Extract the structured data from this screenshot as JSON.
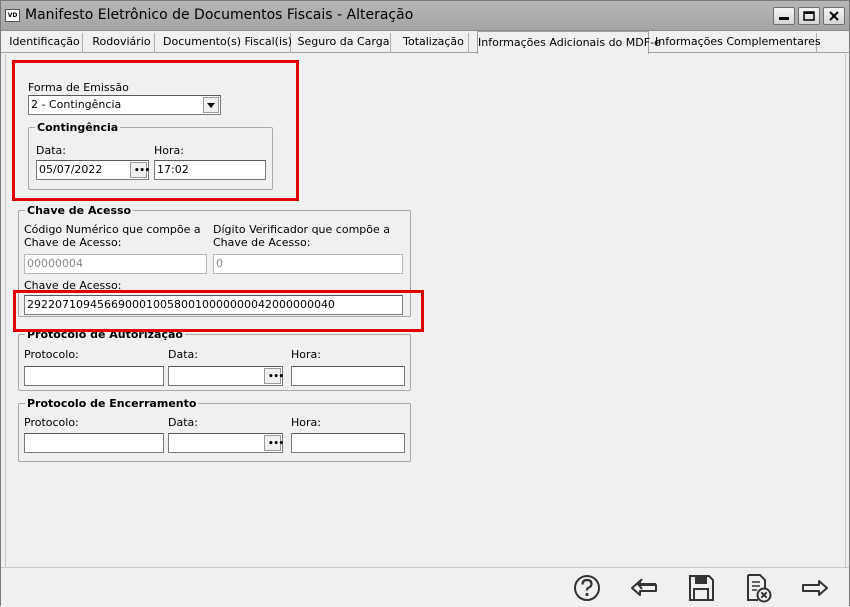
{
  "window": {
    "icon_text": "VD",
    "title": "Manifesto Eletrônico de Documentos Fiscais - Alteração"
  },
  "tabs": [
    {
      "label": "Identificação"
    },
    {
      "label": "Rodoviário"
    },
    {
      "label": "Documento(s) Fiscal(is)"
    },
    {
      "label": "Seguro da Carga"
    },
    {
      "label": "Totalização"
    },
    {
      "label": "Informações Adicionais do MDF-e"
    },
    {
      "label": "Informações Complementares"
    }
  ],
  "emissao": {
    "label": "Forma de Emissão",
    "value": "2 - Contingência"
  },
  "contingencia": {
    "title": "Contingência",
    "date_label": "Data:",
    "date_value": "05/07/2022",
    "time_label": "Hora:",
    "time_value": "17:02"
  },
  "chave": {
    "title": "Chave de Acesso",
    "codigo_label_1": "Código Numérico que compõe a",
    "codigo_label_2": "Chave de Acesso:",
    "codigo_value": "00000004",
    "digito_label_1": "Dígito Verificador que compõe a",
    "digito_label_2": "Chave de Acesso:",
    "digito_value": "0",
    "chave_label": "Chave de Acesso:",
    "chave_value": "29220710945669000100580010000000042000000040"
  },
  "autorizacao": {
    "title": "Protocolo de Autorização",
    "protocolo_label": "Protocolo:",
    "protocolo_value": "",
    "data_label": "Data:",
    "data_value": "",
    "hora_label": "Hora:",
    "hora_value": ""
  },
  "encerramento": {
    "title": "Protocolo de Encerramento",
    "protocolo_label": "Protocolo:",
    "protocolo_value": "",
    "data_label": "Data:",
    "data_value": "",
    "hora_label": "Hora:",
    "hora_value": ""
  },
  "colors": {
    "highlight": "#e00000",
    "titlebar": "#a9a9a9",
    "panel": "#f0f0f0"
  },
  "toolbar_icons": [
    "help-icon",
    "back-arrow-icon",
    "save-icon",
    "cancel-document-icon",
    "forward-arrow-icon"
  ]
}
